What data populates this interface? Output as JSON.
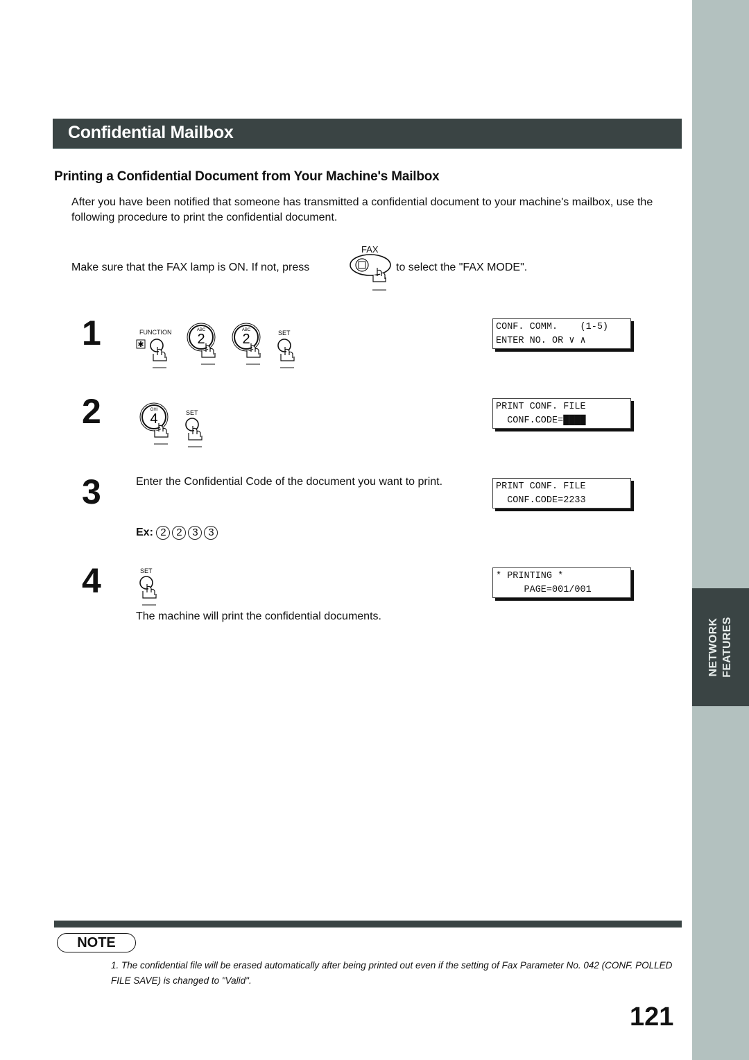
{
  "sidebar": {
    "tab_line1": "NETWORK",
    "tab_line2": "FEATURES",
    "color": "#b3c1bf",
    "tab_color": "#3a4444"
  },
  "header": {
    "title": "Confidential Mailbox",
    "bar_color": "#3a4444"
  },
  "section": {
    "heading": "Printing a Confidential Document from Your Machine's Mailbox",
    "intro": "After you have been notified that someone has transmitted a confidential document to your machine's mailbox, use the following procedure to print the confidential document.",
    "fax_before": "Make sure that the FAX lamp is ON.  If not, press",
    "fax_key_label": "FAX",
    "fax_after": "to select the \"FAX MODE\"."
  },
  "steps": [
    {
      "number": "1",
      "keys": [
        {
          "label": "FUNCTION",
          "glyph": "✱",
          "icon": "function-key-icon"
        },
        {
          "label": "ABC",
          "digit": "2",
          "icon": "key-2-icon"
        },
        {
          "label": "ABC",
          "digit": "2",
          "icon": "key-2-icon"
        },
        {
          "label": "SET",
          "icon": "set-key-icon"
        }
      ],
      "display": [
        "CONF. COMM.    (1-5)",
        "ENTER NO. OR ∨ ∧"
      ]
    },
    {
      "number": "2",
      "keys": [
        {
          "label": "GHI",
          "digit": "4",
          "icon": "key-4-icon"
        },
        {
          "label": "SET",
          "icon": "set-key-icon"
        }
      ],
      "display": [
        "PRINT CONF. FILE",
        "  CONF.CODE=████"
      ]
    },
    {
      "number": "3",
      "text": "Enter the Confidential Code of the document you want to print.",
      "example_label": "Ex:",
      "example_digits": [
        "2",
        "2",
        "3",
        "3"
      ],
      "display": [
        "PRINT CONF. FILE",
        "  CONF.CODE=2233"
      ]
    },
    {
      "number": "4",
      "keys": [
        {
          "label": "SET",
          "icon": "set-key-icon"
        }
      ],
      "text": "The machine will print the confidential documents.",
      "display": [
        "* PRINTING *",
        "     PAGE=001/001"
      ]
    }
  ],
  "note": {
    "badge": "NOTE",
    "items": [
      "1. The confidential file will be erased automatically after being printed out even if the setting of Fax Parameter No. 042 (CONF. POLLED FILE SAVE) is changed to \"Valid\"."
    ]
  },
  "page_number": "121"
}
